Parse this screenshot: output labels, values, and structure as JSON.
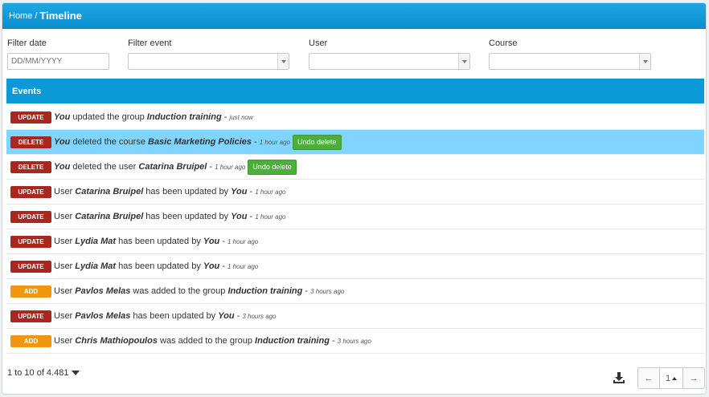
{
  "breadcrumb": {
    "home": "Home",
    "separator": "/",
    "current": "Timeline"
  },
  "filters": {
    "date": {
      "label": "Filter date",
      "placeholder": "DD/MM/YYYY"
    },
    "event": {
      "label": "Filter event",
      "value": ""
    },
    "user": {
      "label": "User",
      "value": ""
    },
    "course": {
      "label": "Course",
      "value": ""
    }
  },
  "events_header": "Events",
  "events": [
    {
      "type": "UPDATE",
      "color": "#a8281f",
      "highlight": false,
      "parts": [
        [
          "You",
          "em"
        ],
        [
          " updated the group ",
          "t"
        ],
        [
          "Induction training",
          "em"
        ],
        [
          " -",
          "t"
        ]
      ],
      "time": "just now",
      "undo": null
    },
    {
      "type": "DELETE",
      "color": "#a8281f",
      "highlight": true,
      "parts": [
        [
          "You",
          "em"
        ],
        [
          " deleted the course ",
          "t"
        ],
        [
          "Basic Marketing Policies",
          "em"
        ],
        [
          " -",
          "t"
        ]
      ],
      "time": "1 hour ago",
      "undo": "Undo delete"
    },
    {
      "type": "DELETE",
      "color": "#a8281f",
      "highlight": false,
      "parts": [
        [
          "You",
          "em"
        ],
        [
          " deleted the user ",
          "t"
        ],
        [
          "Catarina Bruipel",
          "em"
        ],
        [
          " -",
          "t"
        ]
      ],
      "time": "1 hour ago",
      "undo": "Undo delete"
    },
    {
      "type": "UPDATE",
      "color": "#a8281f",
      "highlight": false,
      "parts": [
        [
          "User ",
          "t"
        ],
        [
          "Catarina Bruipel",
          "em"
        ],
        [
          " has been updated by ",
          "t"
        ],
        [
          "You",
          "em"
        ],
        [
          " -",
          "t"
        ]
      ],
      "time": "1 hour ago",
      "undo": null
    },
    {
      "type": "UPDATE",
      "color": "#a8281f",
      "highlight": false,
      "parts": [
        [
          "User ",
          "t"
        ],
        [
          "Catarina Bruipel",
          "em"
        ],
        [
          " has been updated by ",
          "t"
        ],
        [
          "You",
          "em"
        ],
        [
          " -",
          "t"
        ]
      ],
      "time": "1 hour ago",
      "undo": null
    },
    {
      "type": "UPDATE",
      "color": "#a8281f",
      "highlight": false,
      "parts": [
        [
          "User ",
          "t"
        ],
        [
          "Lydia Mat",
          "em"
        ],
        [
          " has been updated by ",
          "t"
        ],
        [
          "You",
          "em"
        ],
        [
          " -",
          "t"
        ]
      ],
      "time": "1 hour ago",
      "undo": null
    },
    {
      "type": "UPDATE",
      "color": "#a8281f",
      "highlight": false,
      "parts": [
        [
          "User ",
          "t"
        ],
        [
          "Lydia Mat",
          "em"
        ],
        [
          " has been updated by ",
          "t"
        ],
        [
          "You",
          "em"
        ],
        [
          " -",
          "t"
        ]
      ],
      "time": "1 hour ago",
      "undo": null
    },
    {
      "type": "ADD",
      "color": "#f0960f",
      "highlight": false,
      "parts": [
        [
          "User ",
          "t"
        ],
        [
          "Pavlos Melas",
          "em"
        ],
        [
          " was added to the group ",
          "t"
        ],
        [
          "Induction training",
          "em"
        ],
        [
          " -",
          "t"
        ]
      ],
      "time": "3 hours ago",
      "undo": null
    },
    {
      "type": "UPDATE",
      "color": "#a8281f",
      "highlight": false,
      "parts": [
        [
          "User ",
          "t"
        ],
        [
          "Pavlos Melas",
          "em"
        ],
        [
          " has been updated by ",
          "t"
        ],
        [
          "You",
          "em"
        ],
        [
          " -",
          "t"
        ]
      ],
      "time": "3 hours ago",
      "undo": null
    },
    {
      "type": "ADD",
      "color": "#f0960f",
      "highlight": false,
      "parts": [
        [
          "User ",
          "t"
        ],
        [
          "Chris Mathiopoulos",
          "em"
        ],
        [
          " was added to the group ",
          "t"
        ],
        [
          "Induction training",
          "em"
        ],
        [
          " -",
          "t"
        ]
      ],
      "time": "3 hours ago",
      "undo": null
    }
  ],
  "footer": {
    "count": "1 to 10 of 4.481",
    "download_icon": "download-icon",
    "pager": {
      "prev": "←",
      "page": "1",
      "next": "→"
    }
  },
  "colors": {
    "header": "#0b8fcf",
    "events_header": "#0a9ad8",
    "highlight": "#7fd5ff",
    "undo": "#4caf3c"
  }
}
